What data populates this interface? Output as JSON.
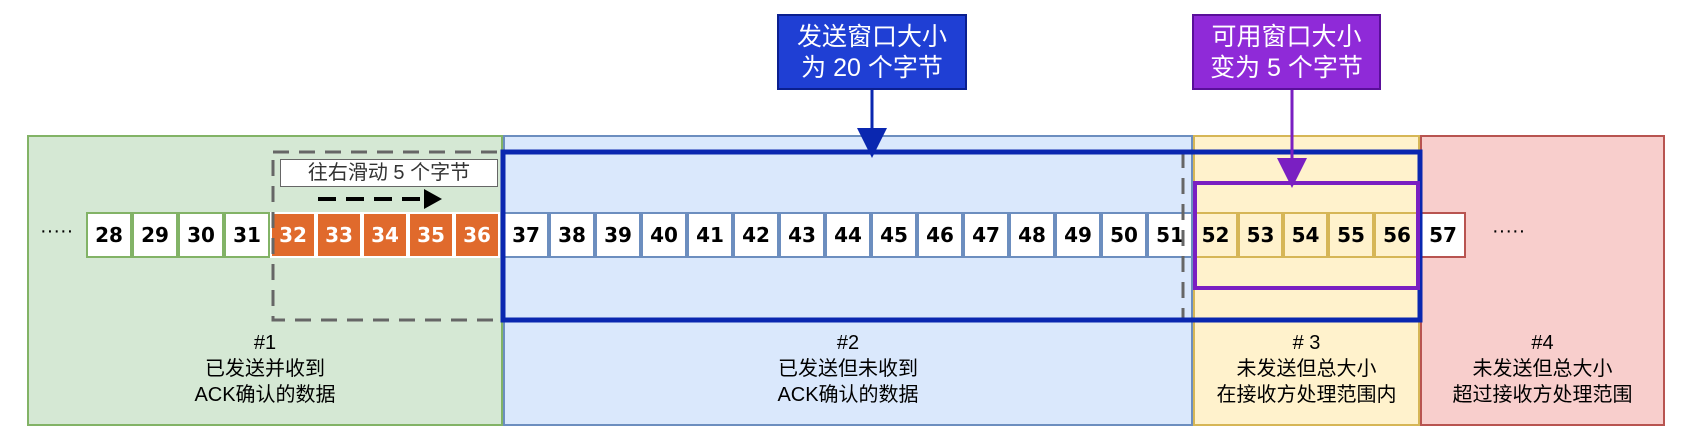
{
  "regions": [
    {
      "id": "#1",
      "line1": "已发送并收到",
      "line2": "ACK确认的数据"
    },
    {
      "id": "#2",
      "line1": "已发送但未收到",
      "line2": "ACK确认的数据"
    },
    {
      "id": "# 3",
      "line1": "未发送但总大小",
      "line2": "在接收方处理范围内"
    },
    {
      "id": "#4",
      "line1": "未发送但总大小",
      "line2": "超过接收方处理范围"
    }
  ],
  "bytes": {
    "sent_acked": [
      "28",
      "29",
      "30",
      "31"
    ],
    "slid": [
      "32",
      "33",
      "34",
      "35",
      "36"
    ],
    "sent_unacked": [
      "37",
      "38",
      "39",
      "40",
      "41",
      "42",
      "43",
      "44",
      "45",
      "46",
      "47",
      "48",
      "49",
      "50",
      "51"
    ],
    "usable": [
      "52",
      "53",
      "54",
      "55",
      "56"
    ],
    "beyond": [
      "57"
    ]
  },
  "ellipsis_left": "·····",
  "ellipsis_right": "·····",
  "callouts": {
    "send_window": {
      "line1": "发送窗口大小",
      "line2": "为 20 个字节"
    },
    "usable_window": {
      "line1": "可用窗口大小",
      "line2": "变为 5 个字节"
    }
  },
  "slide_label": "往右滑动 5  个字节",
  "colors": {
    "slid_bytes": "#e06a2c",
    "send_window_border": "#0a27b0",
    "usable_window_border": "#7a1fc2",
    "old_window_dash": "#666666"
  }
}
